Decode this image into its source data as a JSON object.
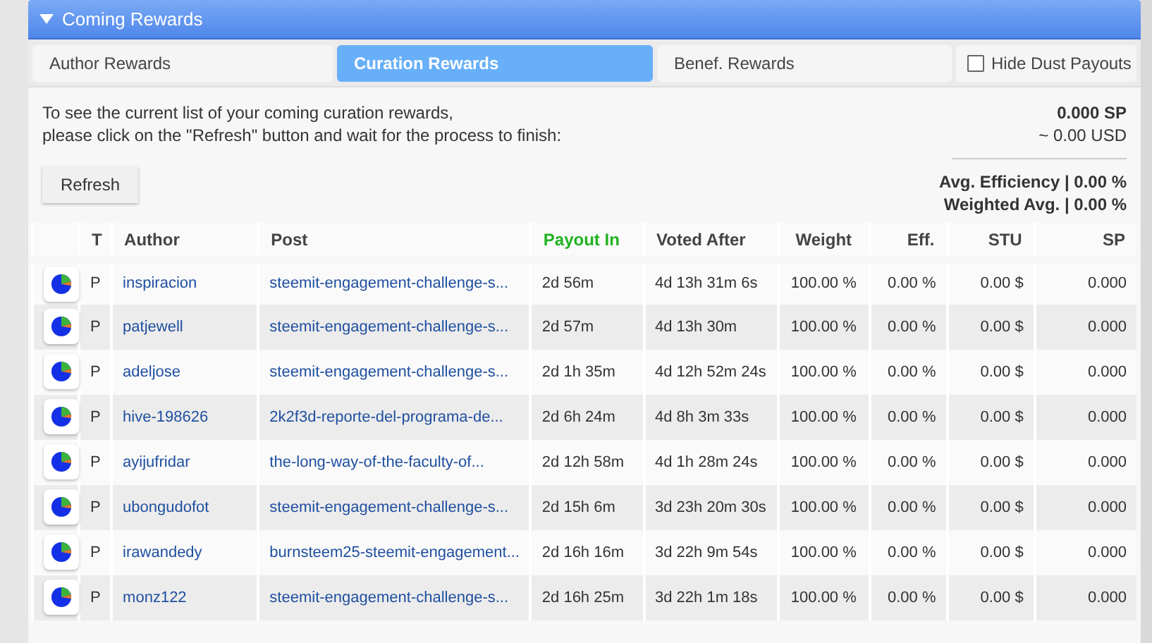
{
  "panel": {
    "title": "Coming Rewards",
    "expanded": true
  },
  "tabs": [
    {
      "label": "Author Rewards",
      "selected": false
    },
    {
      "label": "Curation Rewards",
      "selected": true
    },
    {
      "label": "Benef. Rewards",
      "selected": false
    }
  ],
  "hide_dust": {
    "label": "Hide Dust Payouts",
    "checked": false
  },
  "intro": [
    "To see the current list of your coming curation rewards,",
    "please click on the \"Refresh\" button and wait for the process to finish:"
  ],
  "refresh_button": "Refresh",
  "totals": {
    "sp": "0.000 SP",
    "usd": "~ 0.00 USD",
    "avg_efficiency": "Avg. Efficiency | 0.00 %",
    "weighted_avg": "Weighted Avg. | 0.00 %"
  },
  "table": {
    "columns": [
      {
        "label": "T",
        "sorted": false
      },
      {
        "label": "Author",
        "sorted": false
      },
      {
        "label": "Post",
        "sorted": false
      },
      {
        "label": "Payout In",
        "sorted": true
      },
      {
        "label": "Voted After",
        "sorted": false
      },
      {
        "label": "Weight",
        "sorted": false
      },
      {
        "label": "Eff.",
        "sorted": false
      },
      {
        "label": "STU",
        "sorted": false
      },
      {
        "label": "SP",
        "sorted": false
      }
    ],
    "rows": [
      {
        "type": "P",
        "author": "inspiracion",
        "post": "steemit-engagement-challenge-s...",
        "payout_in": "2d 56m",
        "voted_after": "4d 13h 31m 6s",
        "weight": "100.00 %",
        "eff": "0.00 %",
        "stu": "0.00 $",
        "sp": "0.000"
      },
      {
        "type": "P",
        "author": "patjewell",
        "post": "steemit-engagement-challenge-s...",
        "payout_in": "2d 57m",
        "voted_after": "4d 13h 30m",
        "weight": "100.00 %",
        "eff": "0.00 %",
        "stu": "0.00 $",
        "sp": "0.000"
      },
      {
        "type": "P",
        "author": "adeljose",
        "post": "steemit-engagement-challenge-s...",
        "payout_in": "2d 1h 35m",
        "voted_after": "4d 12h 52m 24s",
        "weight": "100.00 %",
        "eff": "0.00 %",
        "stu": "0.00 $",
        "sp": "0.000"
      },
      {
        "type": "P",
        "author": "hive-198626",
        "post": "2k2f3d-reporte-del-programa-de...",
        "payout_in": "2d 6h 24m",
        "voted_after": "4d 8h 3m 33s",
        "weight": "100.00 %",
        "eff": "0.00 %",
        "stu": "0.00 $",
        "sp": "0.000"
      },
      {
        "type": "P",
        "author": "ayijufridar",
        "post": "the-long-way-of-the-faculty-of...",
        "payout_in": "2d 12h 58m",
        "voted_after": "4d 1h 28m 24s",
        "weight": "100.00 %",
        "eff": "0.00 %",
        "stu": "0.00 $",
        "sp": "0.000"
      },
      {
        "type": "P",
        "author": "ubongudofot",
        "post": "steemit-engagement-challenge-s...",
        "payout_in": "2d 15h 6m",
        "voted_after": "3d 23h 20m 30s",
        "weight": "100.00 %",
        "eff": "0.00 %",
        "stu": "0.00 $",
        "sp": "0.000"
      },
      {
        "type": "P",
        "author": "irawandedy",
        "post": "burnsteem25-steemit-engagement...",
        "payout_in": "2d 16h 16m",
        "voted_after": "3d 22h 9m 54s",
        "weight": "100.00 %",
        "eff": "0.00 %",
        "stu": "0.00 $",
        "sp": "0.000"
      },
      {
        "type": "P",
        "author": "monz122",
        "post": "steemit-engagement-challenge-s...",
        "payout_in": "2d 16h 25m",
        "voted_after": "3d 22h 1m 18s",
        "weight": "100.00 %",
        "eff": "0.00 %",
        "stu": "0.00 $",
        "sp": "0.000"
      }
    ]
  }
}
